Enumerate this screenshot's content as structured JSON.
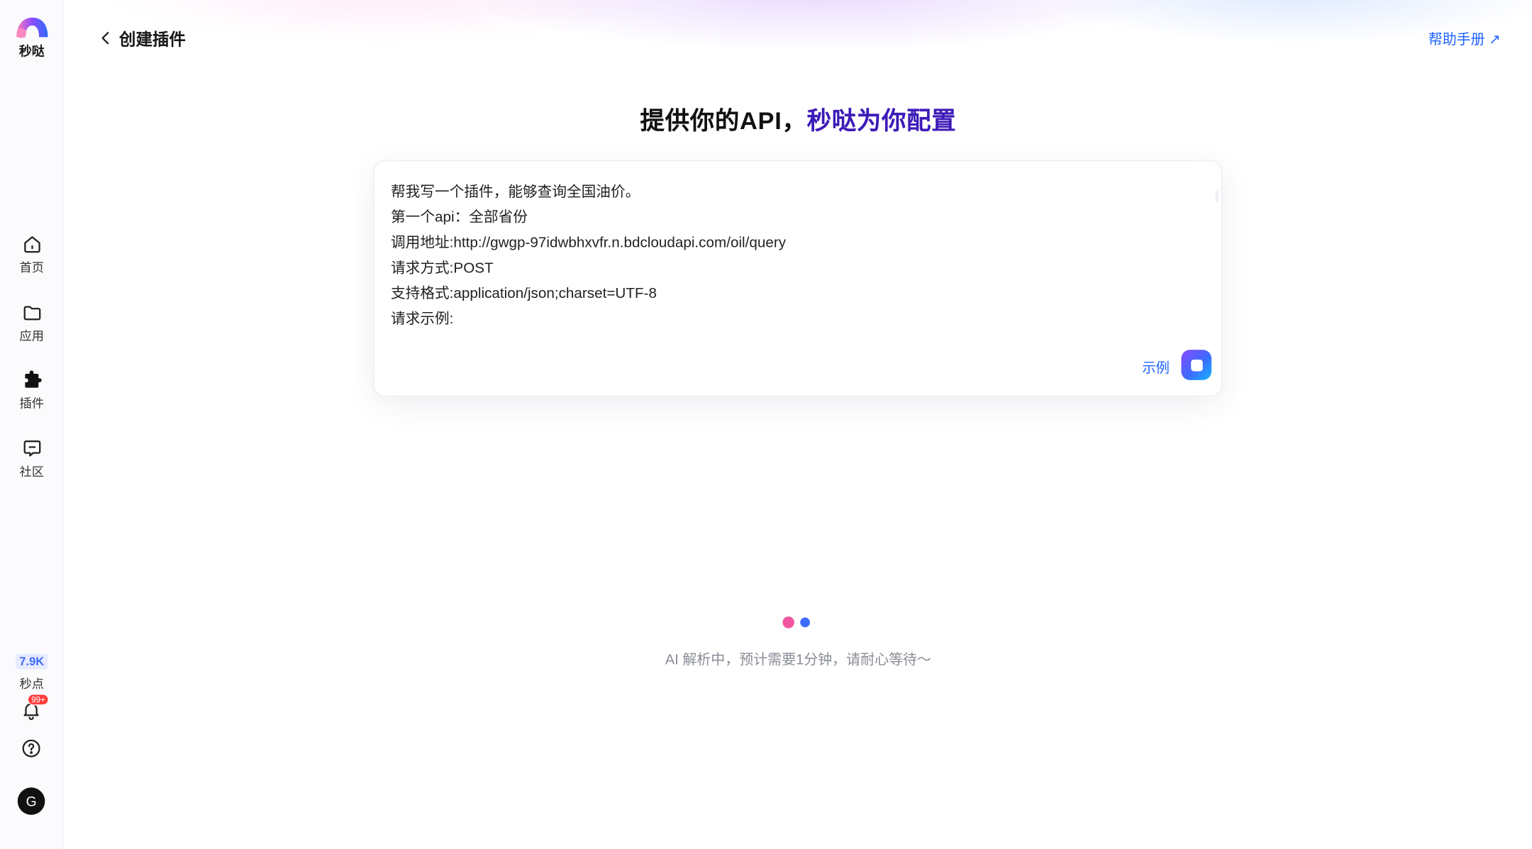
{
  "sidebar": {
    "logo_text": "秒哒",
    "items": [
      {
        "label": "首页",
        "icon": "home-icon"
      },
      {
        "label": "应用",
        "icon": "folder-icon"
      },
      {
        "label": "插件",
        "icon": "puzzle-icon"
      },
      {
        "label": "社区",
        "icon": "chat-icon"
      }
    ],
    "points": {
      "value": "7.9K",
      "label": "秒点"
    },
    "notifications_badge": "99+",
    "avatar_letter": "G"
  },
  "header": {
    "title": "创建插件",
    "help_link": "帮助手册"
  },
  "headline": {
    "part1": "提供你的API，",
    "part2": "秒哒为你配置"
  },
  "editor": {
    "lines": [
      "帮我写一个插件，能够查询全国油价。",
      "第一个api：全部省份",
      "调用地址:http://gwgp-97idwbhxvfr.n.bdcloudapi.com/oil/query",
      "请求方式:POST",
      "支持格式:application/json;charset=UTF-8",
      "请求示例:"
    ],
    "example_label": "示例"
  },
  "status": {
    "loading_text": "AI 解析中，预计需要1分钟，请耐心等待～"
  },
  "colors": {
    "accent": "#1f63ff",
    "headline_highlight": "#3d1bb8",
    "loading_dot_1": "#f0569f",
    "loading_dot_2": "#3d6bff"
  }
}
